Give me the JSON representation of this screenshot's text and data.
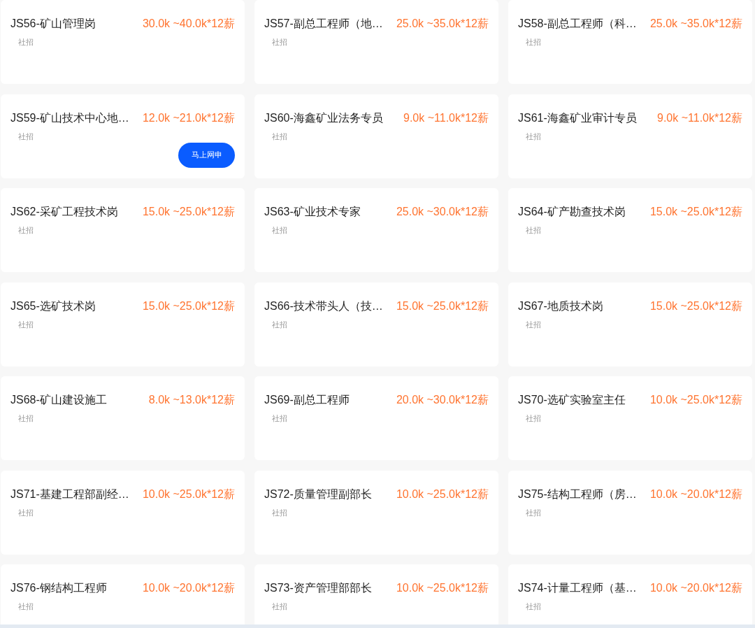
{
  "jobs": [
    {
      "title": "JS56-矿山管理岗",
      "salary": "30.0k ~40.0k*12薪",
      "tag": "社招"
    },
    {
      "title": "JS57-副总工程师（地…",
      "salary": "25.0k ~35.0k*12薪",
      "tag": "社招"
    },
    {
      "title": "JS58-副总工程师（科…",
      "salary": "25.0k ~35.0k*12薪",
      "tag": "社招"
    },
    {
      "title": "JS59-矿山技术中心地…",
      "salary": "12.0k ~21.0k*12薪",
      "tag": "社招",
      "button": "马上网申"
    },
    {
      "title": "JS60-海鑫矿业法务专员",
      "salary": "9.0k ~11.0k*12薪",
      "tag": "社招"
    },
    {
      "title": "JS61-海鑫矿业审计专员",
      "salary": "9.0k ~11.0k*12薪",
      "tag": "社招"
    },
    {
      "title": "JS62-采矿工程技术岗",
      "salary": "15.0k ~25.0k*12薪",
      "tag": "社招"
    },
    {
      "title": "JS63-矿业技术专家",
      "salary": "25.0k ~30.0k*12薪",
      "tag": "社招"
    },
    {
      "title": "JS64-矿产勘查技术岗",
      "salary": "15.0k ~25.0k*12薪",
      "tag": "社招"
    },
    {
      "title": "JS65-选矿技术岗",
      "salary": "15.0k ~25.0k*12薪",
      "tag": "社招"
    },
    {
      "title": "JS66-技术带头人（技…",
      "salary": "15.0k ~25.0k*12薪",
      "tag": "社招"
    },
    {
      "title": "JS67-地质技术岗",
      "salary": "15.0k ~25.0k*12薪",
      "tag": "社招"
    },
    {
      "title": "JS68-矿山建设施工",
      "salary": "8.0k ~13.0k*12薪",
      "tag": "社招"
    },
    {
      "title": "JS69-副总工程师",
      "salary": "20.0k ~30.0k*12薪",
      "tag": "社招"
    },
    {
      "title": "JS70-选矿实验室主任",
      "salary": "10.0k ~25.0k*12薪",
      "tag": "社招"
    },
    {
      "title": "JS71-基建工程部副经…",
      "salary": "10.0k ~25.0k*12薪",
      "tag": "社招"
    },
    {
      "title": "JS72-质量管理副部长",
      "salary": "10.0k ~25.0k*12薪",
      "tag": "社招"
    },
    {
      "title": "JS75-结构工程师（房…",
      "salary": "10.0k ~20.0k*12薪",
      "tag": "社招"
    },
    {
      "title": "JS76-钢结构工程师",
      "salary": "10.0k ~20.0k*12薪",
      "tag": "社招"
    },
    {
      "title": "JS73-资产管理部部长",
      "salary": "10.0k ~25.0k*12薪",
      "tag": "社招"
    },
    {
      "title": "JS74-计量工程师（基…",
      "salary": "10.0k ~20.0k*12薪",
      "tag": "社招"
    }
  ]
}
